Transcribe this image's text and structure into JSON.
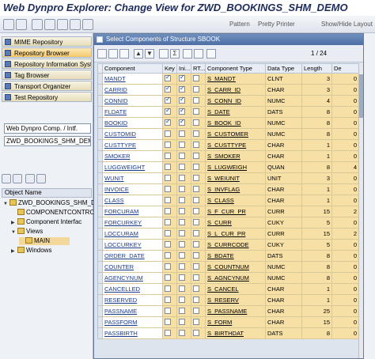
{
  "window": {
    "title": "Web Dynpro Explorer: Change View for ZWD_BOOKINGS_SHM_DEMO"
  },
  "app_toolbar": {
    "pattern_label": "Pattern",
    "pretty_printer_label": "Pretty Printer",
    "show_hide_label": "Show/Hide Layout"
  },
  "left_nav": {
    "repo_buttons": [
      "MIME Repository",
      "Repository Browser",
      "Repository Information Syst",
      "Tag Browser",
      "Transport Organizer",
      "Test Repository"
    ],
    "object_type_select": "Web Dynpro Comp. / Intf.",
    "object_name": "ZWD_BOOKINGS_SHM_DEMO",
    "object_name_header": "Object Name",
    "tree": [
      {
        "label": "ZWD_BOOKINGS_SHM_DEMO",
        "level": 0
      },
      {
        "label": "COMPONENTCONTRO",
        "level": 1
      },
      {
        "label": "Component Interfac",
        "level": 1
      },
      {
        "label": "Views",
        "level": 1
      },
      {
        "label": "MAIN",
        "level": 2
      },
      {
        "label": "Windows",
        "level": 1
      }
    ]
  },
  "dialog": {
    "title": "Select Components of Structure SBOOK",
    "page_current": "1",
    "page_separator": "/",
    "page_total": "24",
    "columns": [
      "Component",
      "Key",
      "Ini...",
      "RT...",
      "Component Type",
      "Data Type",
      "Length",
      "De"
    ],
    "rows": [
      {
        "component": "MANDT",
        "key": true,
        "ini": true,
        "ctype": "S_MANDT",
        "dtype": "CLNT",
        "len": "3",
        "dec": "0"
      },
      {
        "component": "CARRID",
        "key": true,
        "ini": true,
        "ctype": "S_CARR_ID",
        "dtype": "CHAR",
        "len": "3",
        "dec": "0"
      },
      {
        "component": "CONNID",
        "key": true,
        "ini": true,
        "ctype": "S_CONN_ID",
        "dtype": "NUMC",
        "len": "4",
        "dec": "0"
      },
      {
        "component": "FLDATE",
        "key": true,
        "ini": true,
        "ctype": "S_DATE",
        "dtype": "DATS",
        "len": "8",
        "dec": "0"
      },
      {
        "component": "BOOKID",
        "key": true,
        "ini": true,
        "ctype": "S_BOOK_ID",
        "dtype": "NUMC",
        "len": "8",
        "dec": "0"
      },
      {
        "component": "CUSTOMID",
        "key": false,
        "ini": false,
        "ctype": "S_CUSTOMER",
        "dtype": "NUMC",
        "len": "8",
        "dec": "0"
      },
      {
        "component": "CUSTTYPE",
        "key": false,
        "ini": false,
        "ctype": "S_CUSTTYPE",
        "dtype": "CHAR",
        "len": "1",
        "dec": "0"
      },
      {
        "component": "SMOKER",
        "key": false,
        "ini": false,
        "ctype": "S_SMOKER",
        "dtype": "CHAR",
        "len": "1",
        "dec": "0"
      },
      {
        "component": "LUGGWEIGHT",
        "key": false,
        "ini": false,
        "ctype": "S_LUGWEIGH",
        "dtype": "QUAN",
        "len": "8",
        "dec": "4"
      },
      {
        "component": "WUNIT",
        "key": false,
        "ini": false,
        "ctype": "S_WEIUNIT",
        "dtype": "UNIT",
        "len": "3",
        "dec": "0"
      },
      {
        "component": "INVOICE",
        "key": false,
        "ini": false,
        "ctype": "S_INVFLAG",
        "dtype": "CHAR",
        "len": "1",
        "dec": "0"
      },
      {
        "component": "CLASS",
        "key": false,
        "ini": false,
        "ctype": "S_CLASS",
        "dtype": "CHAR",
        "len": "1",
        "dec": "0"
      },
      {
        "component": "FORCURAM",
        "key": false,
        "ini": false,
        "ctype": "S_F_CUR_PR",
        "dtype": "CURR",
        "len": "15",
        "dec": "2"
      },
      {
        "component": "FORCURKEY",
        "key": false,
        "ini": false,
        "ctype": "S_CURR",
        "dtype": "CUKY",
        "len": "5",
        "dec": "0"
      },
      {
        "component": "LOCCURAM",
        "key": false,
        "ini": false,
        "ctype": "S_L_CUR_PR",
        "dtype": "CURR",
        "len": "15",
        "dec": "2"
      },
      {
        "component": "LOCCURKEY",
        "key": false,
        "ini": false,
        "ctype": "S_CURRCODE",
        "dtype": "CUKY",
        "len": "5",
        "dec": "0"
      },
      {
        "component": "ORDER_DATE",
        "key": false,
        "ini": false,
        "ctype": "S_BDATE",
        "dtype": "DATS",
        "len": "8",
        "dec": "0"
      },
      {
        "component": "COUNTER",
        "key": false,
        "ini": false,
        "ctype": "S_COUNTNUM",
        "dtype": "NUMC",
        "len": "8",
        "dec": "0"
      },
      {
        "component": "AGENCYNUM",
        "key": false,
        "ini": false,
        "ctype": "S_AGNCYNUM",
        "dtype": "NUMC",
        "len": "8",
        "dec": "0"
      },
      {
        "component": "CANCELLED",
        "key": false,
        "ini": false,
        "ctype": "S_CANCEL",
        "dtype": "CHAR",
        "len": "1",
        "dec": "0"
      },
      {
        "component": "RESERVED",
        "key": false,
        "ini": false,
        "ctype": "S_RESERV",
        "dtype": "CHAR",
        "len": "1",
        "dec": "0"
      },
      {
        "component": "PASSNAME",
        "key": false,
        "ini": false,
        "ctype": "S_PASSNAME",
        "dtype": "CHAR",
        "len": "25",
        "dec": "0"
      },
      {
        "component": "PASSFORM",
        "key": false,
        "ini": false,
        "ctype": "S_FORM",
        "dtype": "CHAR",
        "len": "15",
        "dec": "0"
      },
      {
        "component": "PASSBIRTH",
        "key": false,
        "ini": false,
        "ctype": "S_BIRTHDAT",
        "dtype": "DATS",
        "len": "8",
        "dec": "0"
      }
    ]
  }
}
